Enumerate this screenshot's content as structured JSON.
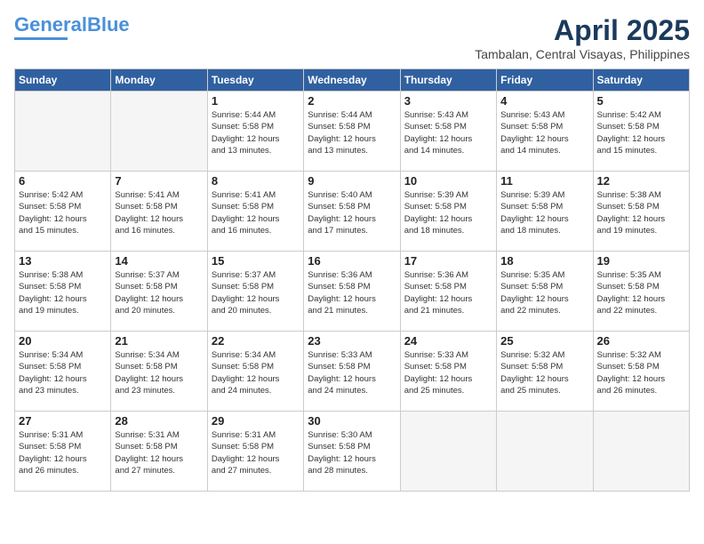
{
  "header": {
    "logo_line1": "General",
    "logo_line2": "Blue",
    "month_year": "April 2025",
    "location": "Tambalan, Central Visayas, Philippines"
  },
  "days_of_week": [
    "Sunday",
    "Monday",
    "Tuesday",
    "Wednesday",
    "Thursday",
    "Friday",
    "Saturday"
  ],
  "weeks": [
    [
      {
        "day": "",
        "info": ""
      },
      {
        "day": "",
        "info": ""
      },
      {
        "day": "1",
        "info": "Sunrise: 5:44 AM\nSunset: 5:58 PM\nDaylight: 12 hours\nand 13 minutes."
      },
      {
        "day": "2",
        "info": "Sunrise: 5:44 AM\nSunset: 5:58 PM\nDaylight: 12 hours\nand 13 minutes."
      },
      {
        "day": "3",
        "info": "Sunrise: 5:43 AM\nSunset: 5:58 PM\nDaylight: 12 hours\nand 14 minutes."
      },
      {
        "day": "4",
        "info": "Sunrise: 5:43 AM\nSunset: 5:58 PM\nDaylight: 12 hours\nand 14 minutes."
      },
      {
        "day": "5",
        "info": "Sunrise: 5:42 AM\nSunset: 5:58 PM\nDaylight: 12 hours\nand 15 minutes."
      }
    ],
    [
      {
        "day": "6",
        "info": "Sunrise: 5:42 AM\nSunset: 5:58 PM\nDaylight: 12 hours\nand 15 minutes."
      },
      {
        "day": "7",
        "info": "Sunrise: 5:41 AM\nSunset: 5:58 PM\nDaylight: 12 hours\nand 16 minutes."
      },
      {
        "day": "8",
        "info": "Sunrise: 5:41 AM\nSunset: 5:58 PM\nDaylight: 12 hours\nand 16 minutes."
      },
      {
        "day": "9",
        "info": "Sunrise: 5:40 AM\nSunset: 5:58 PM\nDaylight: 12 hours\nand 17 minutes."
      },
      {
        "day": "10",
        "info": "Sunrise: 5:39 AM\nSunset: 5:58 PM\nDaylight: 12 hours\nand 18 minutes."
      },
      {
        "day": "11",
        "info": "Sunrise: 5:39 AM\nSunset: 5:58 PM\nDaylight: 12 hours\nand 18 minutes."
      },
      {
        "day": "12",
        "info": "Sunrise: 5:38 AM\nSunset: 5:58 PM\nDaylight: 12 hours\nand 19 minutes."
      }
    ],
    [
      {
        "day": "13",
        "info": "Sunrise: 5:38 AM\nSunset: 5:58 PM\nDaylight: 12 hours\nand 19 minutes."
      },
      {
        "day": "14",
        "info": "Sunrise: 5:37 AM\nSunset: 5:58 PM\nDaylight: 12 hours\nand 20 minutes."
      },
      {
        "day": "15",
        "info": "Sunrise: 5:37 AM\nSunset: 5:58 PM\nDaylight: 12 hours\nand 20 minutes."
      },
      {
        "day": "16",
        "info": "Sunrise: 5:36 AM\nSunset: 5:58 PM\nDaylight: 12 hours\nand 21 minutes."
      },
      {
        "day": "17",
        "info": "Sunrise: 5:36 AM\nSunset: 5:58 PM\nDaylight: 12 hours\nand 21 minutes."
      },
      {
        "day": "18",
        "info": "Sunrise: 5:35 AM\nSunset: 5:58 PM\nDaylight: 12 hours\nand 22 minutes."
      },
      {
        "day": "19",
        "info": "Sunrise: 5:35 AM\nSunset: 5:58 PM\nDaylight: 12 hours\nand 22 minutes."
      }
    ],
    [
      {
        "day": "20",
        "info": "Sunrise: 5:34 AM\nSunset: 5:58 PM\nDaylight: 12 hours\nand 23 minutes."
      },
      {
        "day": "21",
        "info": "Sunrise: 5:34 AM\nSunset: 5:58 PM\nDaylight: 12 hours\nand 23 minutes."
      },
      {
        "day": "22",
        "info": "Sunrise: 5:34 AM\nSunset: 5:58 PM\nDaylight: 12 hours\nand 24 minutes."
      },
      {
        "day": "23",
        "info": "Sunrise: 5:33 AM\nSunset: 5:58 PM\nDaylight: 12 hours\nand 24 minutes."
      },
      {
        "day": "24",
        "info": "Sunrise: 5:33 AM\nSunset: 5:58 PM\nDaylight: 12 hours\nand 25 minutes."
      },
      {
        "day": "25",
        "info": "Sunrise: 5:32 AM\nSunset: 5:58 PM\nDaylight: 12 hours\nand 25 minutes."
      },
      {
        "day": "26",
        "info": "Sunrise: 5:32 AM\nSunset: 5:58 PM\nDaylight: 12 hours\nand 26 minutes."
      }
    ],
    [
      {
        "day": "27",
        "info": "Sunrise: 5:31 AM\nSunset: 5:58 PM\nDaylight: 12 hours\nand 26 minutes."
      },
      {
        "day": "28",
        "info": "Sunrise: 5:31 AM\nSunset: 5:58 PM\nDaylight: 12 hours\nand 27 minutes."
      },
      {
        "day": "29",
        "info": "Sunrise: 5:31 AM\nSunset: 5:58 PM\nDaylight: 12 hours\nand 27 minutes."
      },
      {
        "day": "30",
        "info": "Sunrise: 5:30 AM\nSunset: 5:58 PM\nDaylight: 12 hours\nand 28 minutes."
      },
      {
        "day": "",
        "info": ""
      },
      {
        "day": "",
        "info": ""
      },
      {
        "day": "",
        "info": ""
      }
    ]
  ]
}
